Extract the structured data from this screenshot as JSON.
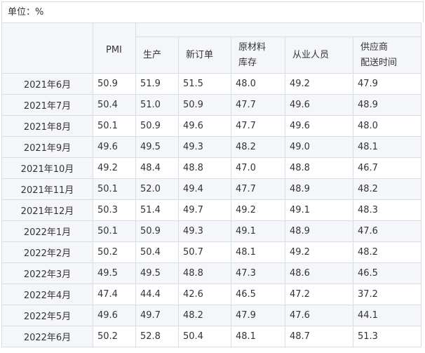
{
  "unit_label": "单位：%",
  "headers": {
    "pmi": "PMI",
    "production": "生产",
    "new_orders": "新订单",
    "raw_material_line1": "原材料",
    "raw_material_line2": "库存",
    "employment": "从业人员",
    "supplier_line1": "供应商",
    "supplier_line2": "配送时间"
  },
  "rows": [
    {
      "month": "2021年6月",
      "pmi": "50.9",
      "production": "51.9",
      "new_orders": "51.5",
      "raw_material": "48.0",
      "employment": "49.2",
      "supplier": "47.9"
    },
    {
      "month": "2021年7月",
      "pmi": "50.4",
      "production": "51.0",
      "new_orders": "50.9",
      "raw_material": "47.7",
      "employment": "49.6",
      "supplier": "48.9"
    },
    {
      "month": "2021年8月",
      "pmi": "50.1",
      "production": "50.9",
      "new_orders": "49.6",
      "raw_material": "47.7",
      "employment": "49.6",
      "supplier": "48.0"
    },
    {
      "month": "2021年9月",
      "pmi": "49.6",
      "production": "49.5",
      "new_orders": "49.3",
      "raw_material": "48.2",
      "employment": "49.0",
      "supplier": "48.1"
    },
    {
      "month": "2021年10月",
      "pmi": "49.2",
      "production": "48.4",
      "new_orders": "48.8",
      "raw_material": "47.0",
      "employment": "48.8",
      "supplier": "46.7"
    },
    {
      "month": "2021年11月",
      "pmi": "50.1",
      "production": "52.0",
      "new_orders": "49.4",
      "raw_material": "47.7",
      "employment": "48.9",
      "supplier": "48.2"
    },
    {
      "month": "2021年12月",
      "pmi": "50.3",
      "production": "51.4",
      "new_orders": "49.7",
      "raw_material": "49.2",
      "employment": "49.1",
      "supplier": "48.3"
    },
    {
      "month": "2022年1月",
      "pmi": "50.1",
      "production": "50.9",
      "new_orders": "49.3",
      "raw_material": "49.1",
      "employment": "48.9",
      "supplier": "47.6"
    },
    {
      "month": "2022年2月",
      "pmi": "50.2",
      "production": "50.4",
      "new_orders": "50.7",
      "raw_material": "48.1",
      "employment": "49.2",
      "supplier": "48.2"
    },
    {
      "month": "2022年3月",
      "pmi": "49.5",
      "production": "49.5",
      "new_orders": "48.8",
      "raw_material": "47.3",
      "employment": "48.6",
      "supplier": "46.5"
    },
    {
      "month": "2022年4月",
      "pmi": "47.4",
      "production": "44.4",
      "new_orders": "42.6",
      "raw_material": "46.5",
      "employment": "47.2",
      "supplier": "37.2"
    },
    {
      "month": "2022年5月",
      "pmi": "49.6",
      "production": "49.7",
      "new_orders": "48.2",
      "raw_material": "47.9",
      "employment": "47.6",
      "supplier": "44.1"
    },
    {
      "month": "2022年6月",
      "pmi": "50.2",
      "production": "52.8",
      "new_orders": "50.4",
      "raw_material": "48.1",
      "employment": "48.7",
      "supplier": "51.3"
    }
  ]
}
